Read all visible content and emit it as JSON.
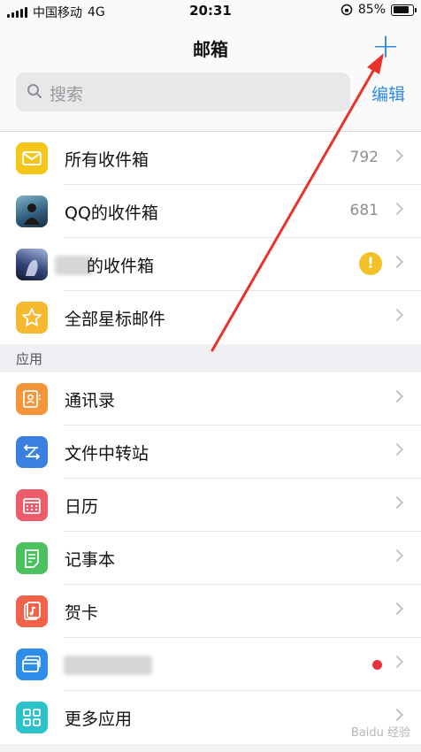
{
  "status_bar": {
    "carrier": "中国移动",
    "network": "4G",
    "time": "20:31",
    "battery": "85%"
  },
  "header": {
    "title": "邮箱",
    "add_icon": "plus-icon",
    "search_placeholder": "搜索",
    "edit_label": "编辑"
  },
  "mailboxes": [
    {
      "label": "所有收件箱",
      "count": "792",
      "icon": "envelope-icon",
      "color": "#f5c518"
    },
    {
      "label": "QQ的收件箱",
      "count": "681",
      "icon": "avatar-image",
      "color": "#3a6f8f"
    },
    {
      "label": "的收件箱",
      "count": "",
      "icon": "avatar-image",
      "color": "#2a3a66",
      "badge": "!"
    },
    {
      "label": "全部星标邮件",
      "count": "",
      "icon": "star-icon",
      "color": "#f5b82e"
    }
  ],
  "apps_section": {
    "title": "应用",
    "items": [
      {
        "label": "通讯录",
        "icon": "contacts-icon",
        "color": "#f5953a"
      },
      {
        "label": "文件中转站",
        "icon": "transfer-icon",
        "color": "#3b7fe0"
      },
      {
        "label": "日历",
        "icon": "calendar-icon",
        "color": "#ee5b6a"
      },
      {
        "label": "记事本",
        "icon": "notebook-icon",
        "color": "#4cc160"
      },
      {
        "label": "贺卡",
        "icon": "card-icon",
        "color": "#f0634a"
      },
      {
        "label": "",
        "icon": "card-stack-icon",
        "color": "#2e8de8",
        "dot": true
      },
      {
        "label": "更多应用",
        "icon": "grid-icon",
        "color": "#2cc2c9"
      }
    ]
  },
  "watermark": "Baidu 经验"
}
